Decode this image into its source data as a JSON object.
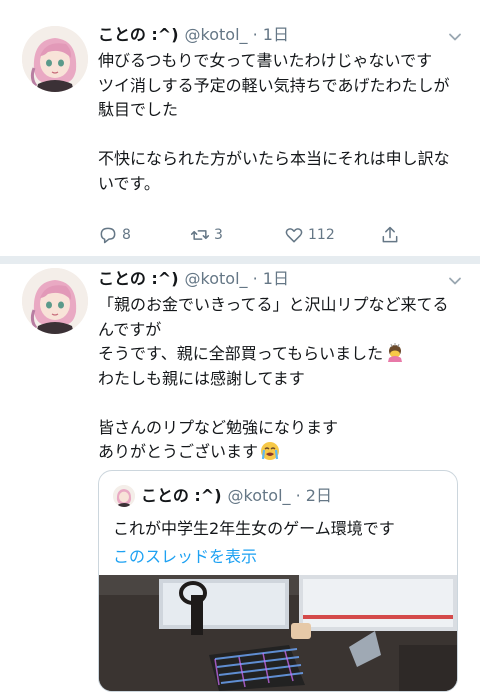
{
  "tweets": [
    {
      "display_name": "ことの :^)",
      "meta": "@kotol_ · 1日",
      "lines": [
        "伸びるつもりで女って書いたわけじゃないです",
        "ツイ消しする予定の軽い気持ちであげたわたしが駄目でした",
        "",
        "不快になられた方がいたら本当にそれは申し訳ないです。"
      ],
      "replies": "8",
      "retweets": "3",
      "likes": "112"
    },
    {
      "display_name": "ことの :^)",
      "meta": "@kotol_ · 1日",
      "lines": [
        "「親のお金でいきってる」と沢山リプなど来てるんですが",
        "そうです、親に全部買ってもらいました",
        "わたしも親には感謝してます",
        "",
        "皆さんのリプなど勉強になります",
        "ありがとうございます"
      ],
      "quote": {
        "display_name": "ことの :^)",
        "meta": "@kotol_ · 2日",
        "text": "これが中学生2年生女のゲーム環境です",
        "link": "このスレッドを表示"
      }
    }
  ],
  "icons": {
    "chevron": "chevron-down-icon",
    "reply": "reply-icon",
    "retweet": "retweet-icon",
    "like": "heart-icon",
    "share": "share-icon"
  },
  "colors": {
    "secondary": "#657786",
    "link": "#1da1f2",
    "divider": "#e6ecf0",
    "avatar_hair": "#e7a6c0"
  }
}
